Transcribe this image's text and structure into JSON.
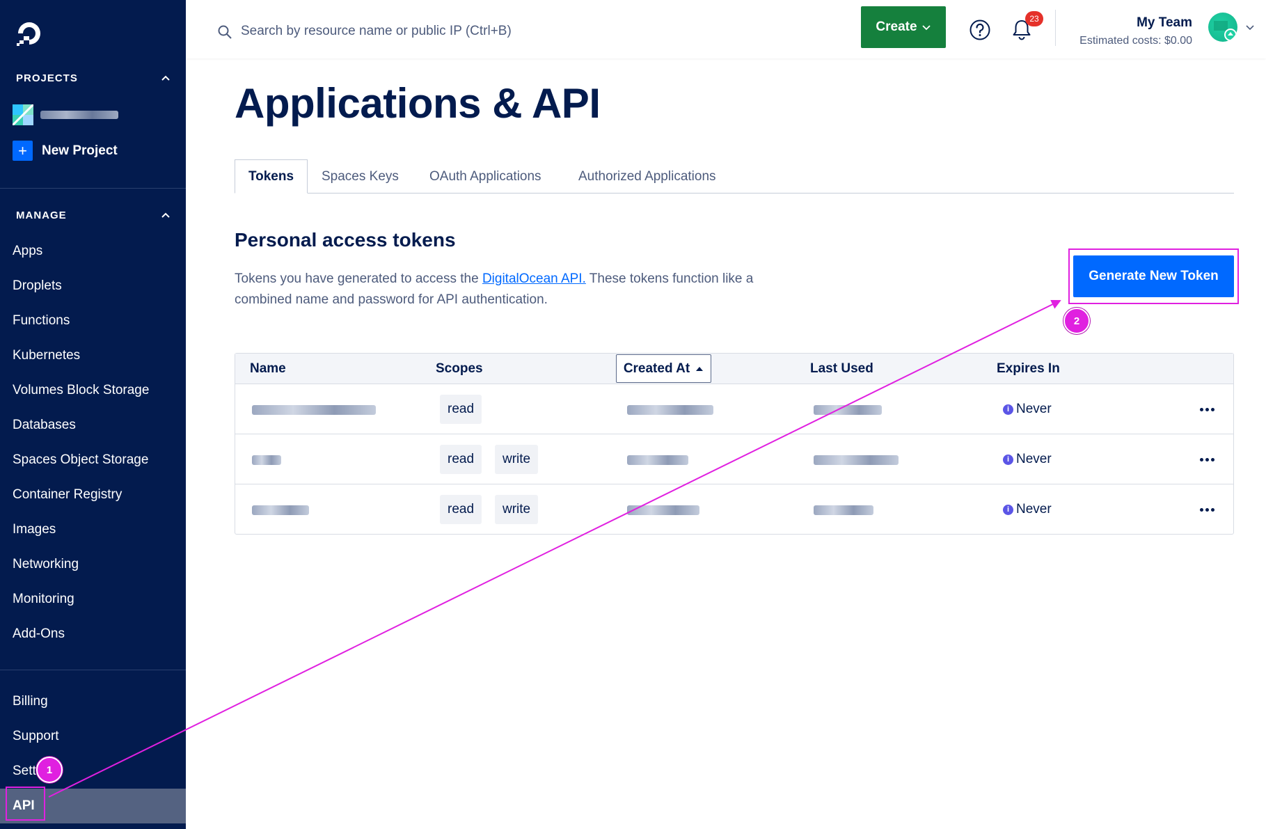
{
  "sidebar": {
    "projects_heading": "PROJECTS",
    "new_project_label": "New Project",
    "manage_heading": "MANAGE",
    "manage_items": [
      {
        "label": "Apps"
      },
      {
        "label": "Droplets"
      },
      {
        "label": "Functions"
      },
      {
        "label": "Kubernetes"
      },
      {
        "label": "Volumes Block Storage"
      },
      {
        "label": "Databases"
      },
      {
        "label": "Spaces Object Storage"
      },
      {
        "label": "Container Registry"
      },
      {
        "label": "Images"
      },
      {
        "label": "Networking"
      },
      {
        "label": "Monitoring"
      },
      {
        "label": "Add-Ons"
      }
    ],
    "bottom_items": [
      {
        "label": "Billing"
      },
      {
        "label": "Support"
      },
      {
        "label": "Sett"
      },
      {
        "label": "API",
        "active": true
      }
    ]
  },
  "topbar": {
    "search_placeholder": "Search by resource name or public IP (Ctrl+B)",
    "create_label": "Create",
    "notifications_count": "23",
    "team_name": "My Team",
    "estimated_costs": "Estimated costs: $0.00"
  },
  "main": {
    "title": "Applications & API",
    "tabs": [
      {
        "label": "Tokens",
        "active": true
      },
      {
        "label": "Spaces Keys"
      },
      {
        "label": "OAuth Applications"
      },
      {
        "label": "Authorized Applications"
      }
    ],
    "section_title": "Personal access tokens",
    "description": {
      "before_link": "Tokens you have generated to access the ",
      "link_text": "DigitalOcean API.",
      "after_link": " These tokens function like a combined name and password for API authentication."
    },
    "generate_button_label": "Generate New Token"
  },
  "tokens_table": {
    "columns": [
      "Name",
      "Scopes",
      "Created At",
      "Last Used",
      "Expires In"
    ],
    "sorted_column": "Created At",
    "sort_direction": "ascending",
    "rows": [
      {
        "scopes": [
          "read"
        ],
        "expires": "Never"
      },
      {
        "scopes": [
          "read",
          "write"
        ],
        "expires": "Never"
      },
      {
        "scopes": [
          "read",
          "write"
        ],
        "expires": "Never"
      }
    ]
  },
  "annotations": {
    "step_1": "1",
    "step_2": "2"
  },
  "colors": {
    "sidebar_bg": "#031b4e",
    "primary_blue": "#0069ff",
    "create_green": "#15803d",
    "annotation_magenta": "#e020e0",
    "badge_red": "#e5312a"
  }
}
